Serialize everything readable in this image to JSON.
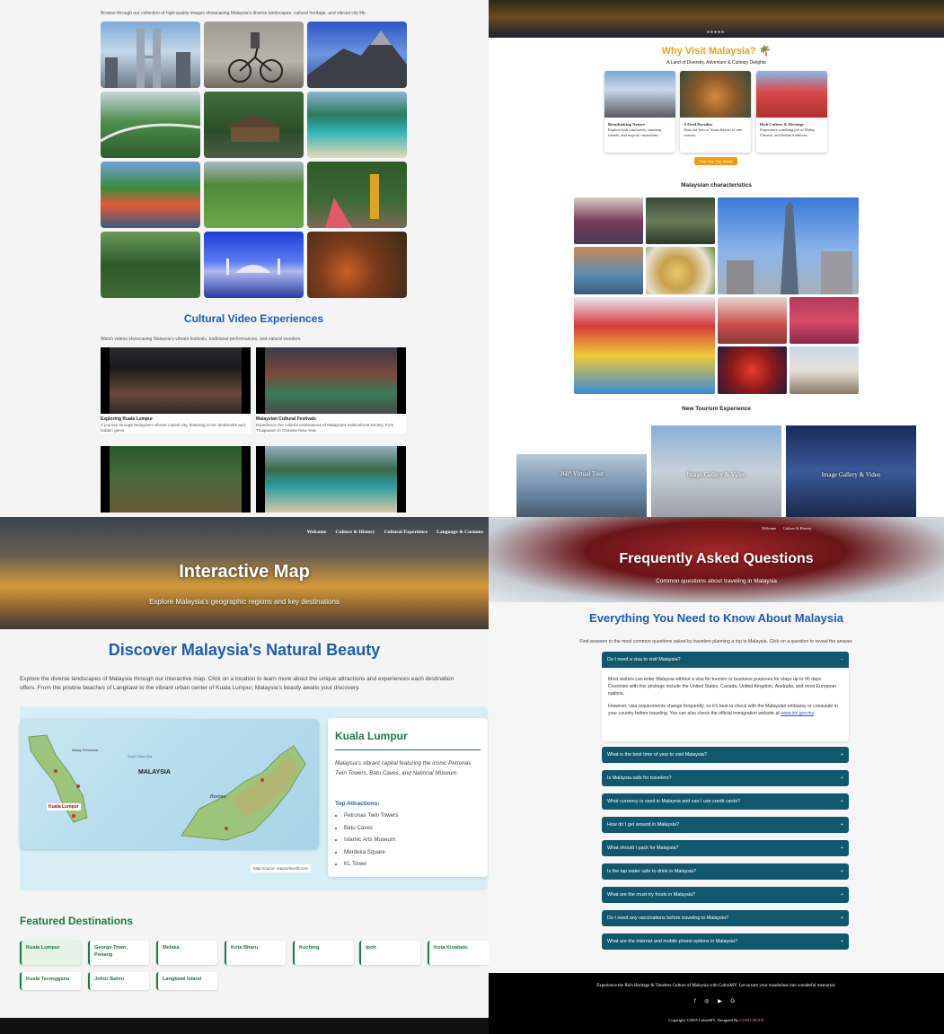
{
  "gallery": {
    "intro": "Browse through our collection of high-quality images showcasing Malaysia's diverse landscapes, cultural heritage, and vibrant city life.",
    "photos": [
      "petronas-towers",
      "bicycle-mural",
      "mount-kinabalu",
      "jungle-bridge",
      "longhouse",
      "island-beach",
      "melaka-riverfront",
      "tea-plantation",
      "batu-caves",
      "canopy-walkway",
      "floating-mosque",
      "malay-feast"
    ]
  },
  "videos": {
    "title": "Cultural Video Experiences",
    "intro": "Watch videos showcasing Malaysia's vibrant festivals, traditional performances, and natural wonders.",
    "items": [
      {
        "title": "Exploring Kuala Lumpur",
        "desc": "A journey through Malaysia's vibrant capital city, featuring iconic landmarks and hidden gems."
      },
      {
        "title": "Malaysian Cultural Festivals",
        "desc": "Experience the colorful celebrations of Malaysia's multicultural society, from Thaipusam to Chinese New Year."
      }
    ]
  },
  "why": {
    "title": "Why Visit Malaysia? 🌴",
    "subtitle": "A Land of Diversity, Adventure & Culinary Delights",
    "features": [
      {
        "title": "Breathtaking Nature",
        "desc": "Explore lush rainforests, stunning islands, and majestic mountains."
      },
      {
        "title": "A Food Paradise",
        "desc": "Taste the best of Asian flavors in one country."
      },
      {
        "title": "Rich Culture & Heritage",
        "desc": "Experience a melting pot of Malay, Chinese, and Indian traditions."
      }
    ],
    "button": "Plan Your Trip Today!",
    "slide_dots": "●●●●●"
  },
  "characteristics": {
    "title": "Malaysian characteristics"
  },
  "new_tourism": {
    "title": "New Tourism Experience",
    "cards": [
      "360° Virtual Tour",
      "Image Gallery & Video",
      "Image Gallery & Video"
    ]
  },
  "map_page": {
    "nav": [
      "Welcome",
      "Culture & History",
      "Cultural Experience",
      "Language & Customs"
    ],
    "hero_title": "Interactive Map",
    "hero_sub": "Explore Malaysia's geographic regions and key destinations",
    "h2": "Discover Malaysia's Natural Beauty",
    "intro": "Explore the diverse landscapes of Malaysia through our interactive map. Click on a location to learn more about the unique attractions and experiences each destination offers. From the pristine beaches of Langkawi to the vibrant urban center of Kuala Lumpur, Malaysia's beauty awaits your discovery.",
    "map_labels": {
      "country": "MALAYSIA",
      "region": "Borneo",
      "pin": "Kuala Lumpur",
      "peninsula": "Malay Peninsula",
      "sea": "South China Sea"
    },
    "map_source": "Map source: mapsofworld.com",
    "info": {
      "name": "Kuala Lumpur",
      "desc": "Malaysia's vibrant capital featuring the iconic Petronas Twin Towers, Batu Caves, and National Museum.",
      "attractions_label": "Top Attractions:",
      "attractions": [
        "Petronas Twin Towers",
        "Batu Caves",
        "Islamic Arts Museum",
        "Merdeka Square",
        "KL Tower"
      ]
    },
    "featured_title": "Featured Destinations",
    "destinations": [
      "Kuala Lumpur",
      "George Town, Penang",
      "Melaka",
      "Kota Bharu",
      "Kuching",
      "Ipoh",
      "Kota Kinabalu",
      "Kuala Terengganu",
      "Johor Bahru",
      "Langkawi Island"
    ]
  },
  "faq_page": {
    "nav": [
      "Welcome",
      "Culture & History"
    ],
    "hero_title": "Frequently Asked Questions",
    "hero_sub": "Common questions about traveling in Malaysia",
    "h2": "Everything You Need to Know About Malaysia",
    "intro": "Find answers to the most common questions asked by travelers planning a trip to Malaysia. Click on a question to reveal the answer.",
    "open_question": "Do I need a visa to visit Malaysia?",
    "answer_p1": "Most visitors can enter Malaysia without a visa for tourism or business purposes for stays up to 90 days. Countries with this privilege include the United States, Canada, United Kingdom, Australia, and most European nations.",
    "answer_p2": "However, visa requirements change frequently, so it's best to check with the Malaysian embassy or consulate in your country before traveling. You can also check the official immigration website at",
    "answer_link": "www.imi.gov.my",
    "collapsed": [
      "What is the best time of year to visit Malaysia?",
      "Is Malaysia safe for travelers?",
      "What currency is used in Malaysia and can I use credit cards?",
      "How do I get around in Malaysia?",
      "What should I pack for Malaysia?",
      "Is the tap water safe to drink in Malaysia?",
      "What are the must-try foods in Malaysia?",
      "Do I need any vaccinations before traveling to Malaysia?",
      "What are the internet and mobile phone options in Malaysia?"
    ],
    "footer_line": "Experience the Rich Heritage & Timeless Culture of Malaysia with CultraMY. Let us turn your wanderlust into wonderful memories.",
    "footer_icons": "f ◎ ▶ G",
    "copyright": "Copyright ©2025 CultraMY. Designed By",
    "designer": "COM GROUP"
  }
}
